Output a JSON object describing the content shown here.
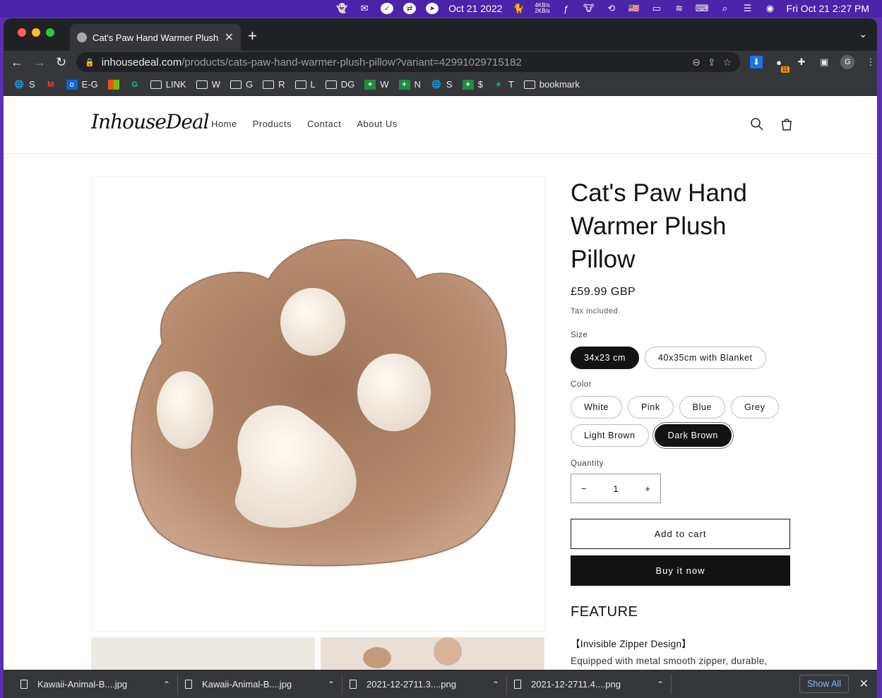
{
  "menubar": {
    "date_widget": "Oct 21 2022",
    "net_up": "4KB/s",
    "net_down": "2KB/s",
    "clock": "Fri Oct 21  2:27 PM"
  },
  "browser": {
    "tab_title": "Cat's Paw Hand Warmer Plush Pillow",
    "url_domain": "inhousedeal.com",
    "url_path": "/products/cats-paw-hand-warmer-plush-pillow?variant=42991029715182",
    "profile_initial": "G",
    "ext_badge": "11",
    "bookmarks": [
      {
        "label": "S",
        "icon": "globe-icon"
      },
      {
        "label": "",
        "icon": "gmail-icon"
      },
      {
        "label": "E-G",
        "icon": "outlook-icon"
      },
      {
        "label": "",
        "icon": "microsoft-icon"
      },
      {
        "label": "",
        "icon": "grammarly-icon"
      },
      {
        "label": "LINK",
        "icon": "folder-icon"
      },
      {
        "label": "W",
        "icon": "folder-icon"
      },
      {
        "label": "G",
        "icon": "folder-icon"
      },
      {
        "label": "R",
        "icon": "folder-icon"
      },
      {
        "label": "L",
        "icon": "folder-icon"
      },
      {
        "label": "DG",
        "icon": "folder-icon"
      },
      {
        "label": "W",
        "icon": "sheets-icon"
      },
      {
        "label": "N",
        "icon": "sheets-icon"
      },
      {
        "label": "S",
        "icon": "globe-icon"
      },
      {
        "label": "$",
        "icon": "sheets-icon"
      },
      {
        "label": "T",
        "icon": "star-icon"
      },
      {
        "label": "bookmark",
        "icon": "folder-icon"
      }
    ]
  },
  "site": {
    "logo": "InhouseDeal",
    "nav": [
      "Home",
      "Products",
      "Contact",
      "About Us"
    ]
  },
  "product": {
    "title": "Cat's Paw Hand Warmer Plush Pillow",
    "price": "£59.99 GBP",
    "tax_note": "Tax included.",
    "size_label": "Size",
    "sizes": [
      "34x23 cm",
      "40x35cm with Blanket"
    ],
    "selected_size": "34x23 cm",
    "color_label": "Color",
    "colors": [
      "White",
      "Pink",
      "Blue",
      "Grey",
      "Light Brown",
      "Dark Brown"
    ],
    "selected_color": "Dark Brown",
    "quantity_label": "Quantity",
    "quantity": "1",
    "add_to_cart": "Add to cart",
    "buy_now": "Buy it now",
    "feature_heading": "FEATURE",
    "feature_title": "【Invisible Zipper Design】",
    "feature_text": "Equipped with metal smooth zipper, durable,"
  },
  "downloads": {
    "files": [
      "Kawaii-Animal-B....jpg",
      "Kawaii-Animal-B....jpg",
      "2021-12-2711.3....png",
      "2021-12-2711.4....png"
    ],
    "show_all": "Show All"
  },
  "colors": {
    "menubar": "#4a23a8",
    "chrome_dark": "#202124",
    "chrome_mid": "#35363a",
    "accent_link": "#8ab4f8",
    "paw_fur": "#b58a6e",
    "paw_pad": "#f4ede4"
  }
}
